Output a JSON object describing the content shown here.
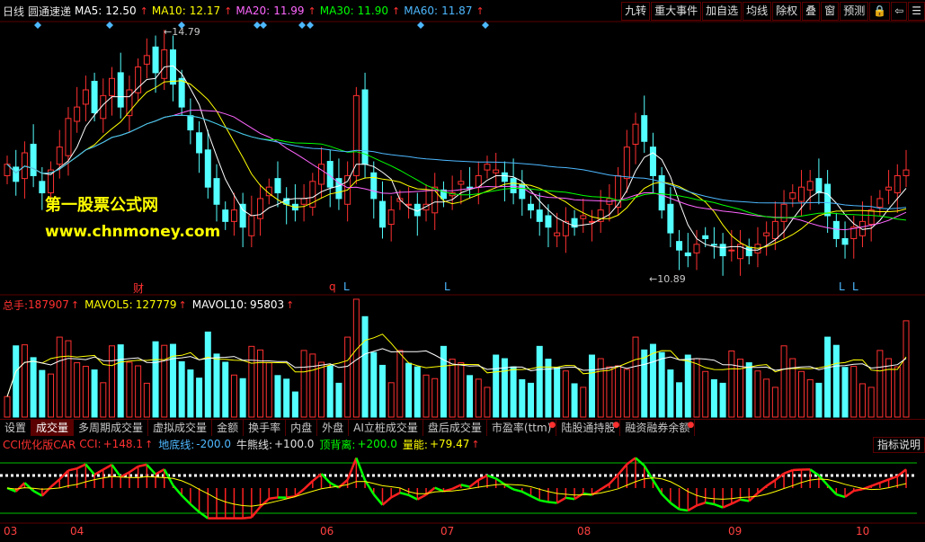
{
  "header": {
    "period": "日线",
    "stock_name": "圆通速递",
    "ma": [
      {
        "label": "MA5:",
        "value": "12.50",
        "color": "#ffffff"
      },
      {
        "label": "MA10:",
        "value": "12.17",
        "color": "#ffff00"
      },
      {
        "label": "MA20:",
        "value": "11.99",
        "color": "#ff66ff"
      },
      {
        "label": "MA30:",
        "value": "11.90",
        "color": "#00ff00"
      },
      {
        "label": "MA60:",
        "value": "11.87",
        "color": "#4db8ff"
      }
    ],
    "arrow": "↑"
  },
  "toolbar": [
    "九转",
    "重大事件",
    "加自选",
    "均线",
    "除权",
    "叠",
    "窗",
    "预测",
    "lock-icon",
    "back-icon",
    "menu-icon"
  ],
  "toolbar_labels": {
    "b0": "九转",
    "b1": "重大事件",
    "b2": "加自选",
    "b3": "均线",
    "b4": "除权",
    "b5": "叠",
    "b6": "窗",
    "b7": "预测",
    "b8": "🔒",
    "b9": "⇦",
    "b10": "☰"
  },
  "watermark": {
    "line1": "第一股票公式网",
    "line2": "www.chnmoney.com"
  },
  "price_annotations": {
    "high": "14.79",
    "low": "10.89",
    "markers": [
      "财",
      "q",
      "L",
      "L",
      "L",
      "L"
    ]
  },
  "volume_header": {
    "total_label": "总手:",
    "total_value": "187907",
    "mavol5_label": "MAVOL5:",
    "mavol5_value": "127779",
    "mavol10_label": "MAVOL10:",
    "mavol10_value": "95803"
  },
  "tabs": [
    "设置",
    "成交量",
    "多周期成交量",
    "虚拟成交量",
    "金额",
    "换手率",
    "内盘",
    "外盘",
    "AI立桩成交量",
    "盘后成交量",
    "市盈率(ttm)",
    "陆股通持股",
    "融资融券余额"
  ],
  "tab_labels": {
    "t0": "设置",
    "t1": "成交量",
    "t2": "多周期成交量",
    "t3": "虚拟成交量",
    "t4": "金额",
    "t5": "换手率",
    "t6": "内盘",
    "t7": "外盘",
    "t8": "AI立桩成交量",
    "t9": "盘后成交量",
    "t10": "市盈率(ttm)",
    "t11": "陆股通持股",
    "t12": "融资融券余额"
  },
  "cci_header": {
    "name": "CCI优化版CAR",
    "cci_label": "CCI:",
    "cci_value": "+148.1",
    "floor_label": "地底线:",
    "floor_value": "-200.0",
    "bull_label": "牛熊线:",
    "bull_value": "+100.0",
    "top_label": "顶背离:",
    "top_value": "+200.0",
    "energy_label": "量能:",
    "energy_value": "+79.47",
    "button": "指标说明"
  },
  "x_axis": [
    "03",
    "04",
    "06",
    "07",
    "08",
    "09",
    "10"
  ],
  "colors": {
    "up": "#ff3030",
    "down": "#54ffff",
    "bg": "#000000",
    "ma5": "#ffffff",
    "ma10": "#ffff00",
    "ma20": "#ff66ff",
    "ma30": "#00ff00",
    "ma60": "#4db8ff"
  },
  "chart_data": {
    "type": "candlestick",
    "price_range": [
      10.6,
      15.0
    ],
    "candles_close_approx": [
      12.6,
      12.3,
      12.8,
      12.4,
      12.1,
      12.5,
      12.9,
      13.4,
      13.6,
      13.9,
      13.5,
      13.8,
      14.1,
      13.6,
      13.9,
      14.3,
      14.5,
      14.2,
      14.6,
      14.0,
      13.6,
      13.2,
      12.8,
      12.2,
      11.9,
      11.6,
      11.8,
      11.5,
      11.7,
      12.0,
      12.2,
      12.1,
      11.9,
      11.8,
      12.0,
      12.3,
      12.6,
      12.2,
      12.0,
      12.4,
      13.8,
      12.6,
      12.0,
      11.5,
      11.8,
      12.0,
      11.9,
      11.7,
      11.9,
      12.2,
      12.0,
      12.1,
      12.3,
      12.2,
      12.4,
      12.6,
      12.5,
      12.3,
      12.1,
      12.0,
      11.8,
      11.6,
      11.5,
      11.4,
      11.6,
      11.5,
      11.7,
      11.6,
      11.8,
      12.0,
      12.4,
      12.9,
      13.3,
      13.0,
      12.4,
      11.8,
      11.4,
      11.1,
      11.0,
      11.2,
      11.3,
      11.2,
      11.0,
      11.1,
      11.2,
      11.0,
      11.2,
      11.4,
      11.6,
      11.9,
      12.1,
      12.2,
      12.3,
      12.1,
      11.7,
      11.3,
      11.2,
      11.5,
      11.6,
      11.8,
      12.0,
      12.2,
      12.4,
      12.5
    ],
    "volume_range": [
      0,
      200000
    ],
    "volume_last": 187907,
    "cci_last": 148.1,
    "cci_lines": {
      "floor": -200.0,
      "bull": 100.0,
      "top": 200.0
    }
  }
}
